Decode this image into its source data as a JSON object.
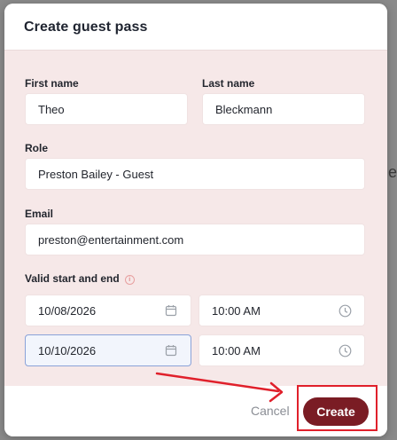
{
  "backdrop": {
    "partial_text": "es"
  },
  "modal": {
    "title": "Create guest pass",
    "fields": {
      "first_name": {
        "label": "First name",
        "value": "Theo"
      },
      "last_name": {
        "label": "Last name",
        "value": "Bleckmann"
      },
      "role": {
        "label": "Role",
        "value": "Preston Bailey - Guest"
      },
      "email": {
        "label": "Email",
        "value": "preston@entertainment.com"
      },
      "validity": {
        "label": "Valid start and end",
        "info_icon": "info-icon",
        "start_date": "10/08/2026",
        "start_time": "10:00 AM",
        "end_date": "10/10/2026",
        "end_time": "10:00 AM"
      }
    },
    "footer": {
      "cancel_label": "Cancel",
      "create_label": "Create"
    }
  },
  "annotations": {
    "highlight_color": "#e0202b",
    "accent": "#7a1c24"
  }
}
